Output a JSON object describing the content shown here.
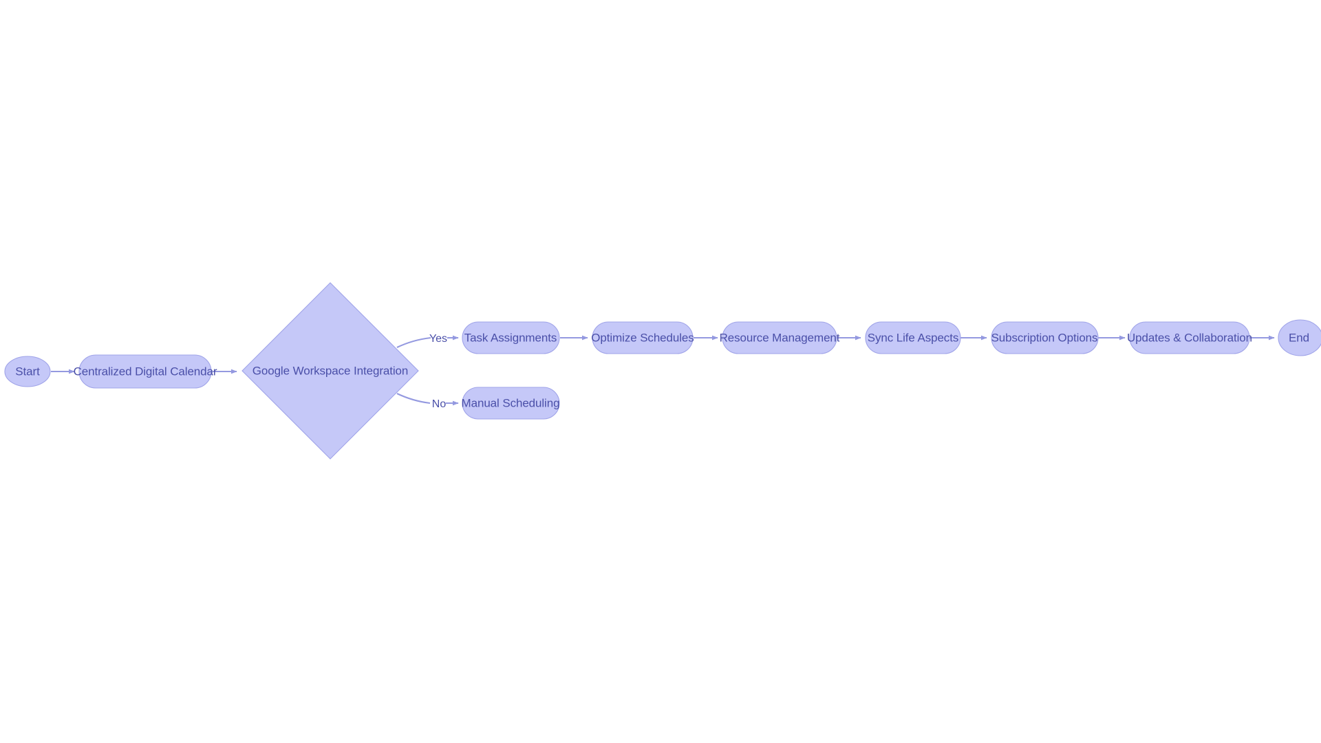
{
  "diagram": {
    "type": "flowchart",
    "orientation": "left-to-right",
    "background_color": "#ffffff",
    "node_fill_color": "#c5c8f8",
    "node_border_color": "#9fa3e8",
    "node_text_color": "#4a4fa8",
    "edge_color": "#9499e0",
    "nodes": [
      {
        "id": "start",
        "label": "Start",
        "shape": "ellipse"
      },
      {
        "id": "calendar",
        "label": "Centralized Digital Calendar",
        "shape": "stadium"
      },
      {
        "id": "decision",
        "label": "Google Workspace Integration",
        "shape": "diamond"
      },
      {
        "id": "task",
        "label": "Task Assignments",
        "shape": "stadium"
      },
      {
        "id": "manual",
        "label": "Manual Scheduling",
        "shape": "stadium"
      },
      {
        "id": "optimize",
        "label": "Optimize Schedules",
        "shape": "stadium"
      },
      {
        "id": "resource",
        "label": "Resource Management",
        "shape": "stadium"
      },
      {
        "id": "sync",
        "label": "Sync Life Aspects",
        "shape": "stadium"
      },
      {
        "id": "subscription",
        "label": "Subscription Options",
        "shape": "stadium"
      },
      {
        "id": "updates",
        "label": "Updates & Collaboration",
        "shape": "stadium"
      },
      {
        "id": "end",
        "label": "End",
        "shape": "ellipse"
      }
    ],
    "edges": [
      {
        "from": "start",
        "to": "calendar",
        "label": ""
      },
      {
        "from": "calendar",
        "to": "decision",
        "label": ""
      },
      {
        "from": "decision",
        "to": "task",
        "label": "Yes"
      },
      {
        "from": "decision",
        "to": "manual",
        "label": "No"
      },
      {
        "from": "task",
        "to": "optimize",
        "label": ""
      },
      {
        "from": "optimize",
        "to": "resource",
        "label": ""
      },
      {
        "from": "resource",
        "to": "sync",
        "label": ""
      },
      {
        "from": "sync",
        "to": "subscription",
        "label": ""
      },
      {
        "from": "subscription",
        "to": "updates",
        "label": ""
      },
      {
        "from": "updates",
        "to": "end",
        "label": ""
      }
    ],
    "edge_labels": {
      "yes": "Yes",
      "no": "No"
    }
  }
}
